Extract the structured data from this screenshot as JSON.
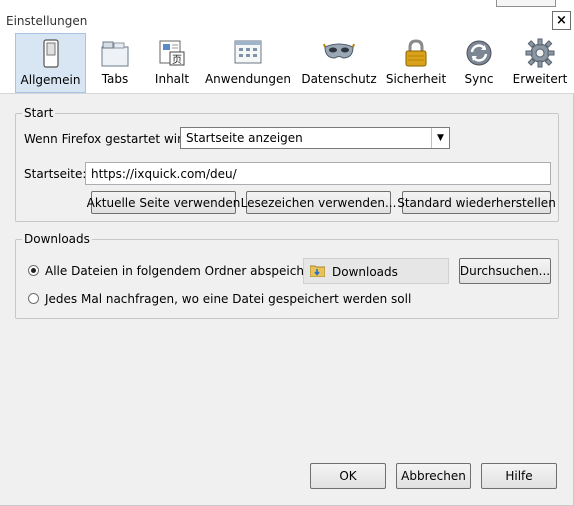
{
  "window": {
    "title": "Einstellungen",
    "close_glyph": "×"
  },
  "toolbar": {
    "items": [
      {
        "label": "Allgemein",
        "icon": "switch-icon",
        "selected": true
      },
      {
        "label": "Tabs",
        "icon": "tabs-icon",
        "selected": false
      },
      {
        "label": "Inhalt",
        "icon": "content-icon",
        "selected": false
      },
      {
        "label": "Anwendungen",
        "icon": "applications-icon",
        "selected": false
      },
      {
        "label": "Datenschutz",
        "icon": "mask-icon",
        "selected": false
      },
      {
        "label": "Sicherheit",
        "icon": "lock-icon",
        "selected": false
      },
      {
        "label": "Sync",
        "icon": "sync-icon",
        "selected": false
      },
      {
        "label": "Erweitert",
        "icon": "gear-icon",
        "selected": false
      }
    ]
  },
  "start": {
    "group_title": "Start",
    "startup_label": "Wenn Firefox gestartet wird:",
    "startup_value": "Startseite anzeigen",
    "homepage_label": "Startseite:",
    "homepage_value": "https://ixquick.com/deu/",
    "btn_current": "Aktuelle Seite verwenden",
    "btn_bookmark": "Lesezeichen verwenden...",
    "btn_restore": "Standard wiederherstellen"
  },
  "downloads": {
    "group_title": "Downloads",
    "radio_save_label": "Alle Dateien in folgendem Ordner abspeichern:",
    "folder_value": "Downloads",
    "btn_browse": "Durchsuchen...",
    "radio_ask_label": "Jedes Mal nachfragen, wo eine Datei gespeichert werden soll",
    "selected_option": "save"
  },
  "footer": {
    "ok": "OK",
    "cancel": "Abbrechen",
    "help": "Hilfe"
  }
}
